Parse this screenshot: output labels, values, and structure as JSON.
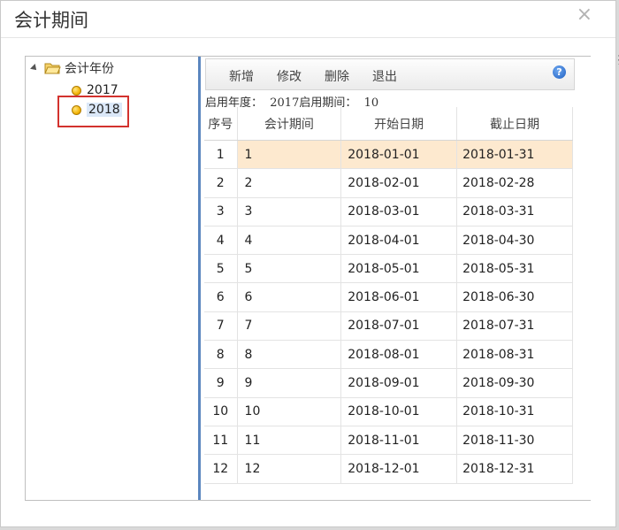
{
  "dialog": {
    "title": "会计期间",
    "close_glyph": "×",
    "edge_glyph": "扌"
  },
  "tree": {
    "root_label": "会计年份",
    "root_icon": "folder-open-icon",
    "items": [
      {
        "label": "2017",
        "icon": "coin-icon",
        "selected": false
      },
      {
        "label": "2018",
        "icon": "coin-icon",
        "selected": true
      }
    ]
  },
  "toolbar": {
    "add_label": "新增",
    "edit_label": "修改",
    "delete_label": "删除",
    "exit_label": "退出",
    "help_glyph": "?"
  },
  "info": {
    "text": "启用年度：  2017启用期间：  10"
  },
  "grid": {
    "headers": [
      "序号",
      "会计期间",
      "开始日期",
      "截止日期"
    ],
    "rows": [
      [
        "1",
        "1",
        "2018-01-01",
        "2018-01-31"
      ],
      [
        "2",
        "2",
        "2018-02-01",
        "2018-02-28"
      ],
      [
        "3",
        "3",
        "2018-03-01",
        "2018-03-31"
      ],
      [
        "4",
        "4",
        "2018-04-01",
        "2018-04-30"
      ],
      [
        "5",
        "5",
        "2018-05-01",
        "2018-05-31"
      ],
      [
        "6",
        "6",
        "2018-06-01",
        "2018-06-30"
      ],
      [
        "7",
        "7",
        "2018-07-01",
        "2018-07-31"
      ],
      [
        "8",
        "8",
        "2018-08-01",
        "2018-08-31"
      ],
      [
        "9",
        "9",
        "2018-09-01",
        "2018-09-30"
      ],
      [
        "10",
        "10",
        "2018-10-01",
        "2018-10-31"
      ],
      [
        "11",
        "11",
        "2018-11-01",
        "2018-11-30"
      ],
      [
        "12",
        "12",
        "2018-12-01",
        "2018-12-31"
      ]
    ],
    "active_row": 0
  },
  "colors": {
    "active_row_bg": "#fde9cf",
    "splitter": "#5b86bf",
    "highlight_border": "#d3322e"
  }
}
